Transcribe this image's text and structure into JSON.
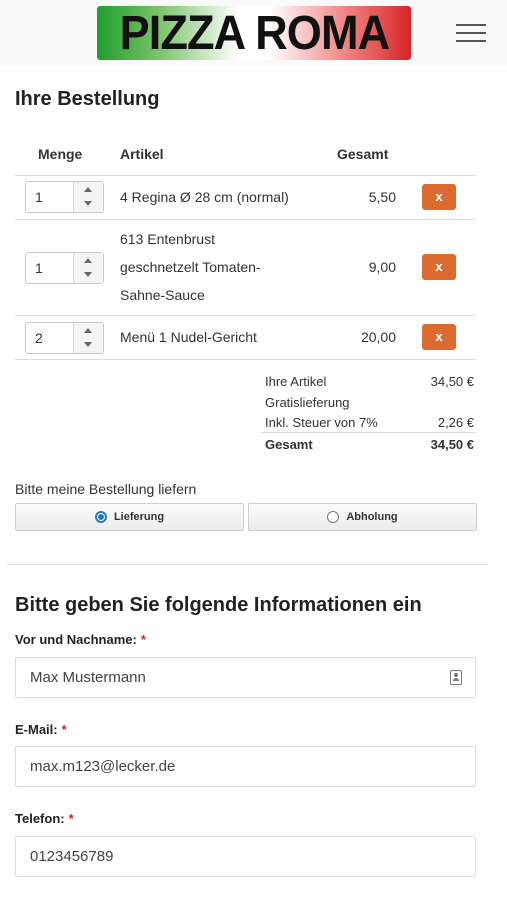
{
  "header": {
    "logo_text": "PIZZA ROMA",
    "menu_icon": "hamburger-menu-icon"
  },
  "order": {
    "title": "Ihre Bestellung",
    "columns": {
      "qty": "Menge",
      "item": "Artikel",
      "total": "Gesamt"
    },
    "rows": [
      {
        "qty": "1",
        "item_lines": [
          "4 Regina Ø 28 cm (normal)"
        ],
        "price": "5,50",
        "remove_label": "x"
      },
      {
        "qty": "1",
        "item_lines": [
          "613 Entenbrust",
          "geschnetzelt Tomaten-",
          "Sahne-Sauce"
        ],
        "price": "9,00",
        "remove_label": "x"
      },
      {
        "qty": "2",
        "item_lines": [
          "Menü 1 Nudel-Gericht"
        ],
        "price": "20,00",
        "remove_label": "x"
      }
    ],
    "summary": {
      "items_label": "Ihre Artikel",
      "items_value": "34,50 €",
      "free_delivery": "Gratislieferung",
      "tax_label": "Inkl. Steuer von 7%",
      "tax_value": "2,26 €",
      "total_label": "Gesamt",
      "total_value": "34,50 €"
    },
    "remove_color": "#dd6b30"
  },
  "delivery": {
    "label": "Bitte meine Bestellung liefern",
    "options": [
      {
        "label": "Lieferung",
        "selected": true
      },
      {
        "label": "Abholung",
        "selected": false
      }
    ]
  },
  "info": {
    "title": "Bitte geben Sie folgende Informationen ein",
    "fields": [
      {
        "label": "Vor und Nachname:",
        "required": "*",
        "value": "Max Mustermann"
      },
      {
        "label": "E-Mail:",
        "required": "*",
        "value": "max.m123@lecker.de"
      },
      {
        "label": "Telefon:",
        "required": "*",
        "value": "0123456789"
      }
    ]
  }
}
